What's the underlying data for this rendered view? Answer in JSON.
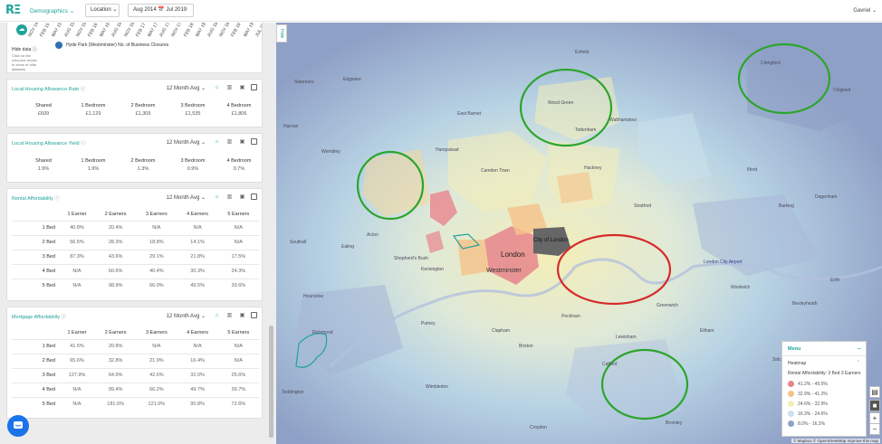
{
  "app": {
    "logo": "RΞ",
    "nav_label": "Demographics",
    "location_label": "Location",
    "date_range": "Aug 2014 📅 Jul 2019",
    "user": "Gavriel"
  },
  "chart_strip": {
    "x_labels": [
      "NOV 14",
      "FEB 15",
      "MAY 15",
      "AUG 15",
      "NOV 15",
      "FEB 16",
      "MAY 16",
      "AUG 16",
      "NOV 16",
      "FEB 17",
      "MAY 17",
      "AUG 17",
      "NOV 17",
      "FEB 18",
      "MAY 18",
      "AUG 18",
      "NOV 18",
      "FEB 19",
      "MAY 19",
      "JUL 19"
    ],
    "hide_data": "Hide data",
    "hide_note": "Click on the coloured circles to show or hide datasets",
    "legend": "Hyde Park (Westminster) No. of Business Closures",
    "legend_color": "#2f6fb0"
  },
  "lha_rate": {
    "title": "Local Housing Allowance Rate",
    "period": "12 Month Avg",
    "headers": [
      "Shared",
      "1 Bedroom",
      "2 Bedroom",
      "3 Bedroom",
      "4 Bedroom"
    ],
    "values": [
      "£609",
      "£1,129",
      "£1,309",
      "£1,535",
      "£1,806"
    ]
  },
  "lha_yield": {
    "title": "Local Housing Allowance Yield",
    "period": "12 Month Avg",
    "headers": [
      "Shared",
      "1 Bedroom",
      "2 Bedroom",
      "3 Bedroom",
      "4 Bedroom"
    ],
    "values": [
      "1.9%",
      "1.9%",
      "1.3%",
      "0.9%",
      "0.7%"
    ]
  },
  "rental": {
    "title": "Rental Affordability",
    "period": "12 Month Avg",
    "headers": [
      "1 Earner",
      "2 Earners",
      "3 Earners",
      "4 Earners",
      "5 Earners"
    ],
    "rows": [
      {
        "label": "1 Bed",
        "cells": [
          "40.8%",
          "20.4%",
          "N/A",
          "N/A",
          "N/A"
        ]
      },
      {
        "label": "2 Bed",
        "cells": [
          "56.5%",
          "28.3%",
          "18.8%",
          "14.1%",
          "N/A"
        ]
      },
      {
        "label": "3 Bed",
        "cells": [
          "87.3%",
          "43.6%",
          "29.1%",
          "21.8%",
          "17.5%"
        ]
      },
      {
        "label": "4 Bed",
        "cells": [
          "N/A",
          "60.6%",
          "40.4%",
          "30.3%",
          "24.3%"
        ]
      },
      {
        "label": "5 Bed",
        "cells": [
          "N/A",
          "98.9%",
          "66.0%",
          "49.5%",
          "39.6%"
        ]
      }
    ]
  },
  "mortgage": {
    "title": "Mortgage Affordability",
    "period": "12 Month Avg",
    "headers": [
      "1 Earner",
      "2 Earners",
      "3 Earners",
      "4 Earners",
      "5 Earners"
    ],
    "rows": [
      {
        "label": "1 Bed",
        "cells": [
          "41.5%",
          "20.8%",
          "N/A",
          "N/A",
          "N/A"
        ]
      },
      {
        "label": "2 Bed",
        "cells": [
          "65.6%",
          "32.8%",
          "21.9%",
          "16.4%",
          "N/A"
        ]
      },
      {
        "label": "3 Bed",
        "cells": [
          "127.9%",
          "64.0%",
          "42.6%",
          "32.0%",
          "25.6%"
        ]
      },
      {
        "label": "4 Bed",
        "cells": [
          "N/A",
          "99.4%",
          "66.2%",
          "49.7%",
          "39.7%"
        ]
      },
      {
        "label": "5 Bed",
        "cells": [
          "N/A",
          "181.6%",
          "121.0%",
          "90.8%",
          "72.6%"
        ]
      }
    ]
  },
  "map": {
    "hide_tab": "Hide",
    "places": [
      "Edgware",
      "Stanmore",
      "Enfield",
      "Chingford",
      "Chigwell",
      "Wood Green",
      "Tottenham",
      "Walthamstow",
      "East Barnet",
      "Harrow",
      "Wembley",
      "Hampstead",
      "Camden Town",
      "Hackney",
      "Stratford",
      "Ilford",
      "Barking",
      "Dagenham",
      "Southall",
      "Ealing",
      "Acton",
      "Shepherd's Bush",
      "Kensington",
      "Westminster",
      "London",
      "City of London",
      "Greenwich",
      "Woolwich",
      "London City Airport",
      "Brixton",
      "Clapham",
      "Richmond",
      "Wimbledon",
      "Croydon",
      "Teddington",
      "Lewisham",
      "Catford",
      "Bromley",
      "Eltham",
      "Sidcup",
      "Bexleyheath",
      "Erith",
      "Hounslow",
      "Putney",
      "Peckham"
    ],
    "attribution": "© Mapbox © OpenStreetMap  Improve this map"
  },
  "menu": {
    "title": "Menu",
    "heatmap_label": "Heatmap",
    "subtitle": "Rental Affordability: 3 Bed 3 Earners",
    "legend": [
      {
        "label": "41.2% - 49.5%",
        "color": "#e8858c"
      },
      {
        "label": "32.9% - 41.2%",
        "color": "#f5c28a"
      },
      {
        "label": "24.6% - 32.9%",
        "color": "#f4eeb8"
      },
      {
        "label": "16.3% - 24.6%",
        "color": "#c9e2ee"
      },
      {
        "label": "8.0% - 16.3%",
        "color": "#8fa3c9"
      }
    ]
  },
  "colors": {
    "accent": "#1fa49a",
    "good_circle": "#2ca52c",
    "bad_circle": "#d62a2a"
  }
}
